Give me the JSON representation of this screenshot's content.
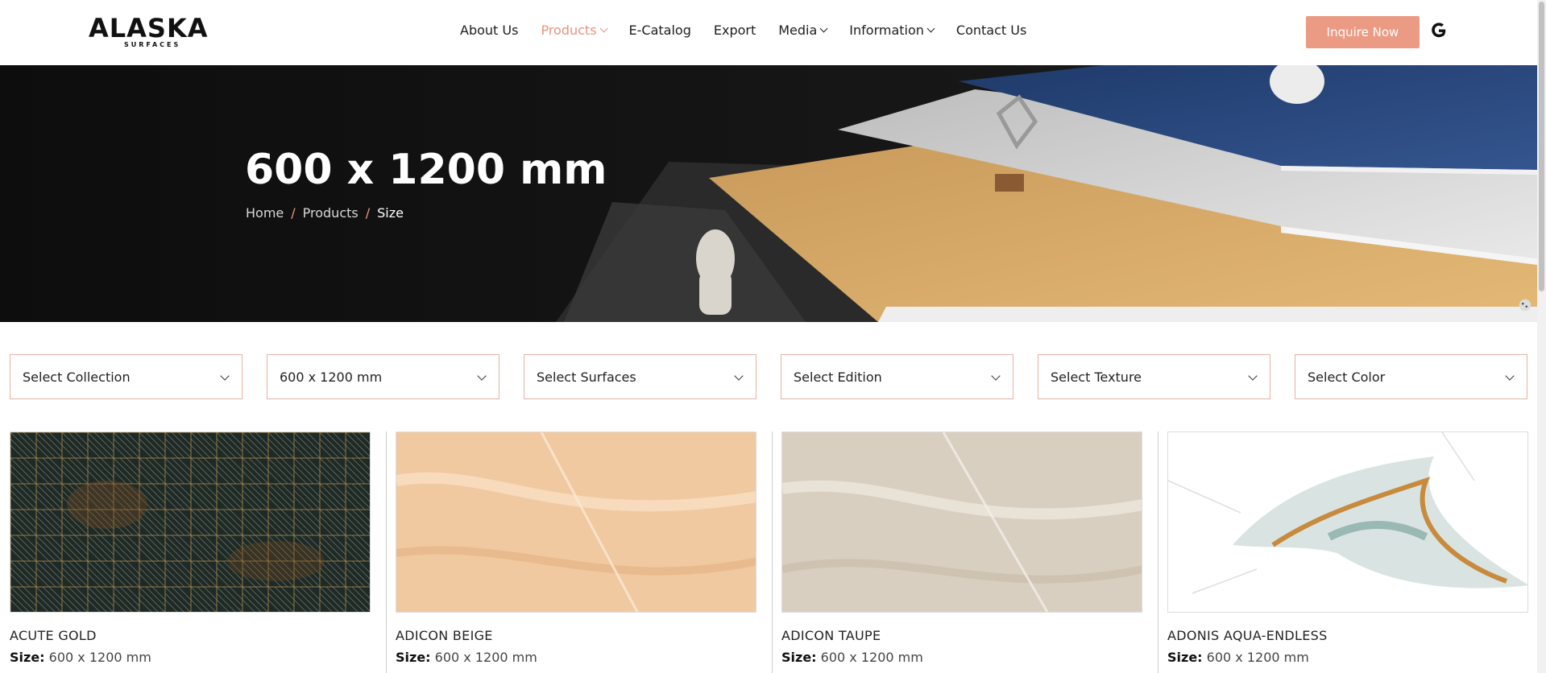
{
  "brand": {
    "name": "ALASKA",
    "tagline": "SURFACES"
  },
  "nav": {
    "items": [
      {
        "label": "About Us",
        "dropdown": false
      },
      {
        "label": "Products",
        "dropdown": true,
        "active": true
      },
      {
        "label": "E-Catalog",
        "dropdown": false
      },
      {
        "label": "Export",
        "dropdown": false
      },
      {
        "label": "Media",
        "dropdown": true
      },
      {
        "label": "Information",
        "dropdown": true
      },
      {
        "label": "Contact Us",
        "dropdown": false
      }
    ],
    "cta_label": "Inquire Now",
    "translate_icon": "google-icon"
  },
  "hero": {
    "title": "600 x 1200 mm",
    "breadcrumb": [
      "Home",
      "Products",
      "Size"
    ]
  },
  "filters": [
    {
      "value": "Select Collection"
    },
    {
      "value": "600 x 1200 mm"
    },
    {
      "value": "Select Surfaces"
    },
    {
      "value": "Select Edition"
    },
    {
      "value": "Select Texture"
    },
    {
      "value": "Select Color"
    }
  ],
  "products": [
    {
      "name": "ACUTE GOLD",
      "size_label": "Size:",
      "size": "600 x 1200 mm"
    },
    {
      "name": "ADICON BEIGE",
      "size_label": "Size:",
      "size": "600 x 1200 mm"
    },
    {
      "name": "ADICON TAUPE",
      "size_label": "Size:",
      "size": "600 x 1200 mm"
    },
    {
      "name": "ADONIS AQUA-ENDLESS",
      "size_label": "Size:",
      "size": "600 x 1200 mm"
    }
  ],
  "colors": {
    "accent": "#eb9b84",
    "border": "#e6b3a5",
    "hero_bg": "#111111"
  }
}
